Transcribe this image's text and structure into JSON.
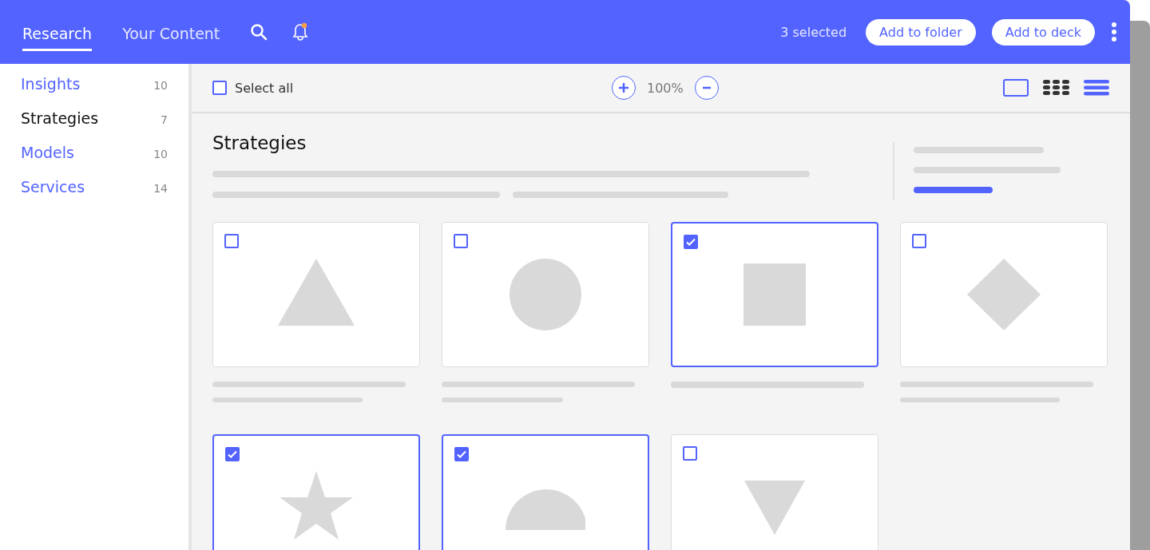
{
  "header": {
    "tabs": [
      {
        "label": "Research",
        "selected": true
      },
      {
        "label": "Your Content",
        "selected": false
      }
    ],
    "selection_count": "3 selected",
    "buttons": [
      "Add to folder",
      "Add to deck"
    ]
  },
  "sidebar": {
    "items": [
      {
        "label": "Insights",
        "count": "10",
        "selected": false
      },
      {
        "label": "Strategies",
        "count": "7",
        "selected": true
      },
      {
        "label": "Models",
        "count": "10",
        "selected": false
      },
      {
        "label": "Services",
        "count": "14",
        "selected": false
      }
    ]
  },
  "toolbar": {
    "select_all": {
      "label": "Select all",
      "checked": false
    },
    "zoom": "100%"
  },
  "section": {
    "title": "Strategies"
  },
  "cards": [
    {
      "kind": "triangle",
      "checked": false
    },
    {
      "kind": "circle",
      "checked": false
    },
    {
      "kind": "square",
      "checked": true
    },
    {
      "kind": "diamond",
      "checked": false
    },
    {
      "kind": "star",
      "checked": true
    },
    {
      "kind": "half-circle",
      "checked": true
    },
    {
      "kind": "inverted-triangle",
      "checked": false
    }
  ]
}
